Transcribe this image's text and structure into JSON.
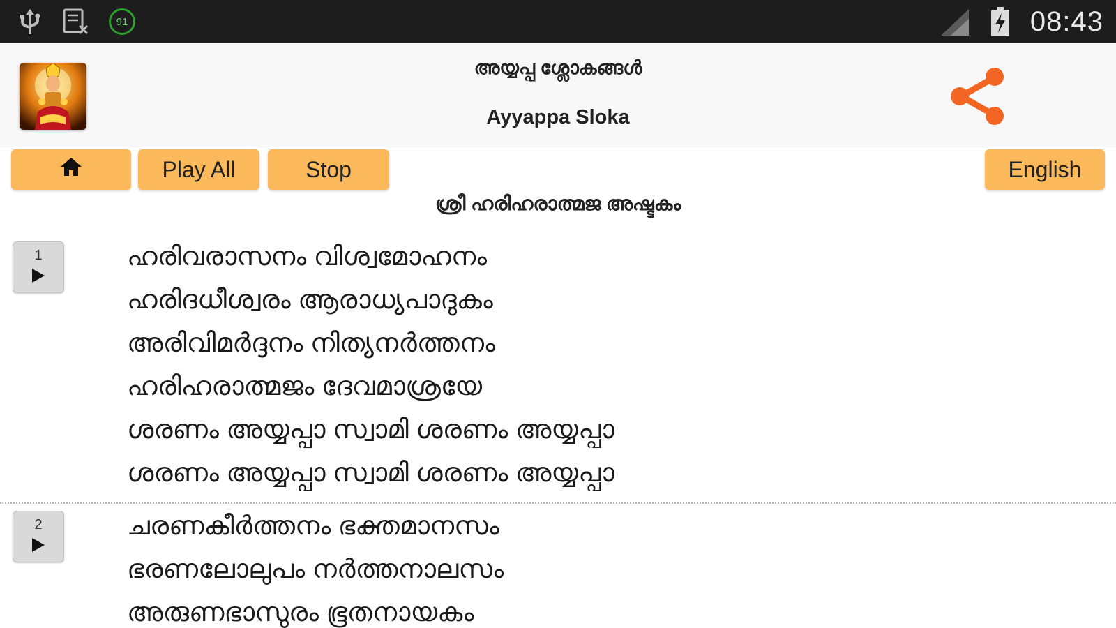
{
  "status_bar": {
    "time": "08:43",
    "battery_percent": "91",
    "left_icons": [
      "usb-icon",
      "screenshot-icon",
      "battery-level-icon"
    ],
    "right_icons": [
      "signal-icon",
      "battery-charging-icon"
    ]
  },
  "header": {
    "title_malayalam": "അയ്യപ്പ ശ്ലോകങ്ങൾ",
    "title_english": "Ayyappa Sloka",
    "logo_icon": "ayyappa-image",
    "share_icon": "share-icon",
    "accent_color": "#f26522"
  },
  "toolbar": {
    "home_icon": "home-icon",
    "play_all_label": "Play All",
    "stop_label": "Stop",
    "language_label": "English",
    "button_color": "#fbb95c"
  },
  "section_title": "ശ്രീ ഹരിഹരാത്മജ അഷ്ടകം",
  "verses": [
    {
      "number": "1",
      "lines": [
        "ഹരിവരാസനം വിശ്വമോഹനം",
        "ഹരിദധീശ്വരം ആരാധ്യപാദുകം",
        "അരിവിമർദ്ദനം നിത്യനർത്തനം",
        "ഹരിഹരാത്മജം ദേവമാശ്രയേ",
        "ശരണം അയ്യപ്പാ സ്വാമി ശരണം അയ്യപ്പാ",
        "ശരണം അയ്യപ്പാ സ്വാമി ശരണം അയ്യപ്പാ"
      ]
    },
    {
      "number": "2",
      "lines": [
        "ചരണകീർത്തനം ഭക്തമാനസം",
        "ഭരണലോലുപം നർത്തനാലസം",
        "അരുണഭാസുരം ഭൂതനായകം"
      ]
    }
  ]
}
